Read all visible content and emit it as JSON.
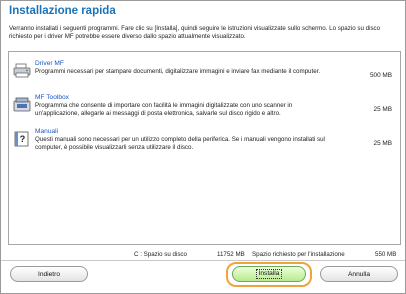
{
  "title": "Installazione rapida",
  "description": "Verranno installati i seguenti programmi. Fare clic su [Installa], quindi seguire le istruzioni visualizzate sullo schermo. Lo spazio su disco richiesto per i driver MF potrebbe essere diverso dallo spazio attualmente visualizzato.",
  "items": [
    {
      "name": "Driver MF",
      "text": "Programmi necessari per stampare documenti, digitalizzare immagini e inviare fax mediante il computer.",
      "size": "500 MB",
      "icon": "printer-icon"
    },
    {
      "name": "MF Toolbox",
      "text": "Programma che consente di importare con facilità le immagini digitalizzate con uno scanner in un'applicazione, allegarle ai messaggi di posta elettronica, salvarle sul disco rigido e altro.",
      "size": "25 MB",
      "icon": "toolbox-icon"
    },
    {
      "name": "Manuali",
      "text": "Questi manuali sono necessari per un utilizzo completo della periferica. Se i manuali vengono installati sul computer, è possibile visualizzarli senza utilizzare il disco.",
      "size": "25 MB",
      "icon": "manual-icon"
    }
  ],
  "disk": {
    "label": "C : Spazio su disco",
    "free": "11752 MB",
    "required_label": "Spazio richiesto per l'installazione",
    "required": "550 MB"
  },
  "buttons": {
    "back": "Indietro",
    "install": "Installa",
    "cancel": "Annulla"
  },
  "colors": {
    "title": "#1a73b8",
    "install_highlight": "#f0a33b",
    "install_fill": "#b9ea90"
  }
}
